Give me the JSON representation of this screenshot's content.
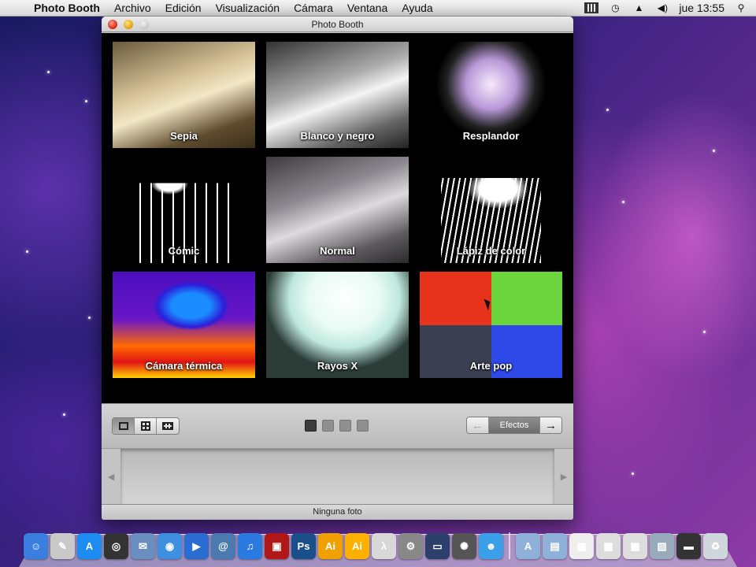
{
  "menubar": {
    "apple_symbol": "",
    "items": [
      "Photo Booth",
      "Archivo",
      "Edición",
      "Visualización",
      "Cámara",
      "Ventana",
      "Ayuda"
    ],
    "clock": "jue 13:55",
    "status_icons": [
      "screen-record-icon",
      "time-machine-icon",
      "eject-icon",
      "volume-icon",
      "spotlight-icon"
    ]
  },
  "window": {
    "title": "Photo Booth",
    "effects": [
      {
        "label": "Sepia",
        "style": "sepia"
      },
      {
        "label": "Blanco y negro",
        "style": "bw"
      },
      {
        "label": "Resplandor",
        "style": "glow"
      },
      {
        "label": "Cómic",
        "style": "comic"
      },
      {
        "label": "Normal",
        "style": "normal"
      },
      {
        "label": "Lápiz de color",
        "style": "pencil"
      },
      {
        "label": "Cámara térmica",
        "style": "thermal"
      },
      {
        "label": "Rayos X",
        "style": "xray"
      },
      {
        "label": "Arte pop",
        "style": "popart"
      }
    ],
    "toolbar": {
      "view_modes": [
        "single-photo-icon",
        "four-up-icon",
        "movie-icon"
      ],
      "active_view": 0,
      "page_count": 4,
      "active_page": 1,
      "effects_label": "Efectos",
      "prev_icon": "←",
      "next_icon": "→"
    },
    "status": "Ninguna foto"
  },
  "dock": {
    "icons": [
      {
        "name": "finder-icon",
        "glyph": "☺",
        "color": "#3a7fe0"
      },
      {
        "name": "preview-icon",
        "glyph": "✎",
        "color": "#c9c9c9"
      },
      {
        "name": "app-store-icon",
        "glyph": "A",
        "color": "#1d8cf0"
      },
      {
        "name": "dashboard-icon",
        "glyph": "◎",
        "color": "#333"
      },
      {
        "name": "mail-icon",
        "glyph": "✉",
        "color": "#6a8fbf"
      },
      {
        "name": "safari-icon",
        "glyph": "◉",
        "color": "#3f8fe0"
      },
      {
        "name": "facetime-icon",
        "glyph": "▶",
        "color": "#2a6cd1"
      },
      {
        "name": "address-book-icon",
        "glyph": "@",
        "color": "#4a7ab0"
      },
      {
        "name": "itunes-icon",
        "glyph": "♫",
        "color": "#2b7ae0"
      },
      {
        "name": "photo-booth-icon",
        "glyph": "▣",
        "color": "#b01717"
      },
      {
        "name": "photoshop-icon",
        "glyph": "Ps",
        "color": "#1b4f8a"
      },
      {
        "name": "illustrator-icon",
        "glyph": "Ai",
        "color": "#f0a000"
      },
      {
        "name": "illustrator-alt-icon",
        "glyph": "Ai",
        "color": "#ffb000"
      },
      {
        "name": "acrobat-icon",
        "glyph": "λ",
        "color": "#d8d8d8"
      },
      {
        "name": "system-preferences-icon",
        "glyph": "⚙",
        "color": "#888"
      },
      {
        "name": "imovie-icon",
        "glyph": "▭",
        "color": "#2d3f6b"
      },
      {
        "name": "itunes-visualizer-icon",
        "glyph": "✺",
        "color": "#555"
      },
      {
        "name": "messenger-icon",
        "glyph": "☻",
        "color": "#3ba0e8"
      },
      {
        "name": "applications-folder-icon",
        "glyph": "A",
        "color": "#8fb0d8"
      },
      {
        "name": "documents-folder-icon",
        "glyph": "▤",
        "color": "#8fb0d8"
      },
      {
        "name": "document-stack-icon",
        "glyph": "▦",
        "color": "#eee"
      },
      {
        "name": "document-stack-2-icon",
        "glyph": "▦",
        "color": "#ddd"
      },
      {
        "name": "document-stack-3-icon",
        "glyph": "▦",
        "color": "#ddd"
      },
      {
        "name": "image-stack-icon",
        "glyph": "▨",
        "color": "#9ab"
      },
      {
        "name": "drive-stack-icon",
        "glyph": "▬",
        "color": "#333"
      },
      {
        "name": "trash-icon",
        "glyph": "♻",
        "color": "#cfd6dc"
      }
    ]
  }
}
